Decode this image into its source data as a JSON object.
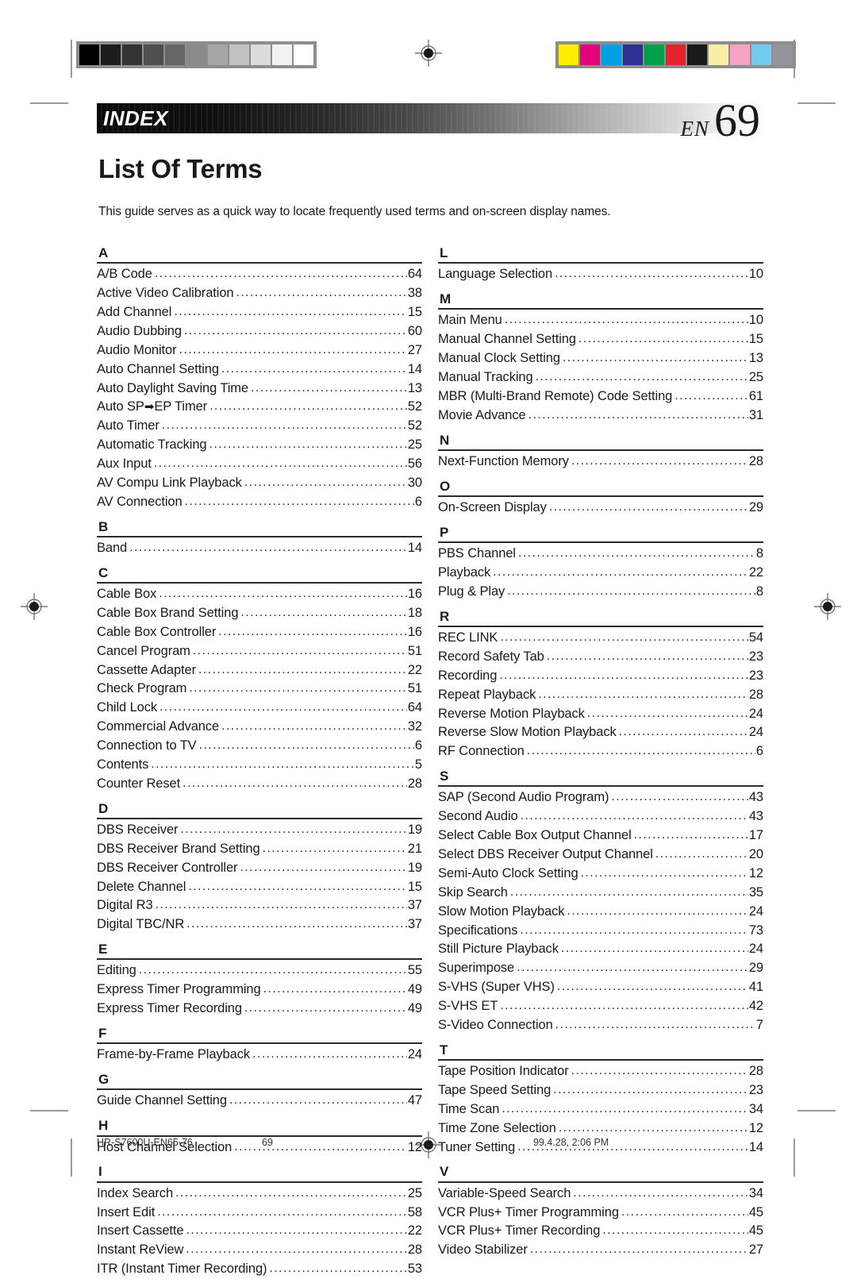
{
  "header": {
    "section_label": "INDEX",
    "locale_code": "EN",
    "page_number": "69"
  },
  "title": "List Of Terms",
  "intro": "This guide serves as a quick way to locate frequently used terms and on-screen display names.",
  "calibration": {
    "grayscale_steps": [
      "#000000",
      "#1c1c1c",
      "#333333",
      "#4f4f4f",
      "#666666",
      "#8a8a8a",
      "#a6a6a6",
      "#c2c2c2",
      "#dcdcdc",
      "#f2f2f2",
      "#ffffff"
    ],
    "color_steps": [
      "#ffec00",
      "#e5007e",
      "#00a0e3",
      "#2e3192",
      "#00a04a",
      "#e8222a",
      "#1a1a1a",
      "#faeea0",
      "#f4a3c4",
      "#6fcdf2",
      "#939598"
    ]
  },
  "columns": [
    {
      "groups": [
        {
          "letter": "A",
          "entries": [
            {
              "term": "A/B Code",
              "page": "64"
            },
            {
              "term": "Active Video Calibration",
              "page": "38"
            },
            {
              "term": "Add Channel",
              "page": "15"
            },
            {
              "term": "Audio Dubbing",
              "page": "60"
            },
            {
              "term": "Audio Monitor",
              "page": "27"
            },
            {
              "term": "Auto Channel Setting",
              "page": "14"
            },
            {
              "term": "Auto Daylight Saving Time",
              "page": "13"
            },
            {
              "term": "Auto SP→EP Timer",
              "page": "52"
            },
            {
              "term": "Auto Timer",
              "page": "52"
            },
            {
              "term": "Automatic Tracking",
              "page": "25"
            },
            {
              "term": "Aux Input",
              "page": "56"
            },
            {
              "term": "AV Compu Link Playback",
              "page": "30"
            },
            {
              "term": "AV Connection",
              "page": "6"
            }
          ]
        },
        {
          "letter": "B",
          "entries": [
            {
              "term": "Band",
              "page": "14"
            }
          ]
        },
        {
          "letter": "C",
          "entries": [
            {
              "term": "Cable Box",
              "page": "16"
            },
            {
              "term": "Cable Box Brand Setting",
              "page": "18"
            },
            {
              "term": "Cable Box Controller",
              "page": "16"
            },
            {
              "term": "Cancel Program",
              "page": "51"
            },
            {
              "term": "Cassette Adapter",
              "page": "22"
            },
            {
              "term": "Check Program",
              "page": "51"
            },
            {
              "term": "Child Lock",
              "page": "64"
            },
            {
              "term": "Commercial Advance",
              "page": "32"
            },
            {
              "term": "Connection to TV",
              "page": "6"
            },
            {
              "term": "Contents",
              "page": "5"
            },
            {
              "term": "Counter Reset",
              "page": "28"
            }
          ]
        },
        {
          "letter": "D",
          "entries": [
            {
              "term": "DBS Receiver",
              "page": "19"
            },
            {
              "term": "DBS Receiver Brand Setting",
              "page": "21"
            },
            {
              "term": "DBS Receiver Controller",
              "page": "19"
            },
            {
              "term": "Delete Channel",
              "page": "15"
            },
            {
              "term": "Digital R3",
              "page": "37"
            },
            {
              "term": "Digital TBC/NR",
              "page": "37"
            }
          ]
        },
        {
          "letter": "E",
          "entries": [
            {
              "term": "Editing",
              "page": "55"
            },
            {
              "term": "Express Timer Programming",
              "page": "49"
            },
            {
              "term": "Express Timer Recording",
              "page": "49"
            }
          ]
        },
        {
          "letter": "F",
          "entries": [
            {
              "term": "Frame-by-Frame Playback",
              "page": "24"
            }
          ]
        },
        {
          "letter": "G",
          "entries": [
            {
              "term": "Guide Channel Setting",
              "page": "47"
            }
          ]
        },
        {
          "letter": "H",
          "entries": [
            {
              "term": "Host Channel Selection",
              "page": "12"
            }
          ]
        },
        {
          "letter": "I",
          "entries": [
            {
              "term": "Index Search",
              "page": "25"
            },
            {
              "term": "Insert Edit",
              "page": "58"
            },
            {
              "term": "Insert Cassette",
              "page": "22"
            },
            {
              "term": "Instant ReView",
              "page": "28"
            },
            {
              "term": "ITR (Instant Timer Recording)",
              "page": "53"
            }
          ]
        }
      ]
    },
    {
      "groups": [
        {
          "letter": "L",
          "entries": [
            {
              "term": "Language Selection",
              "page": "10"
            }
          ]
        },
        {
          "letter": "M",
          "entries": [
            {
              "term": "Main Menu",
              "page": "10"
            },
            {
              "term": "Manual Channel Setting",
              "page": "15"
            },
            {
              "term": "Manual Clock Setting",
              "page": "13"
            },
            {
              "term": "Manual Tracking",
              "page": "25"
            },
            {
              "term": "MBR (Multi-Brand Remote) Code Setting",
              "page": "61"
            },
            {
              "term": "Movie Advance",
              "page": "31"
            }
          ]
        },
        {
          "letter": "N",
          "entries": [
            {
              "term": "Next-Function Memory",
              "page": "28"
            }
          ]
        },
        {
          "letter": "O",
          "entries": [
            {
              "term": "On-Screen Display",
              "page": "29"
            }
          ]
        },
        {
          "letter": "P",
          "entries": [
            {
              "term": "PBS Channel",
              "page": "8"
            },
            {
              "term": "Playback",
              "page": "22"
            },
            {
              "term": "Plug & Play",
              "page": "8"
            }
          ]
        },
        {
          "letter": "R",
          "entries": [
            {
              "term": "REC LINK",
              "page": "54"
            },
            {
              "term": "Record Safety Tab",
              "page": "23"
            },
            {
              "term": "Recording",
              "page": "23"
            },
            {
              "term": "Repeat Playback",
              "page": "28"
            },
            {
              "term": "Reverse Motion Playback",
              "page": "24"
            },
            {
              "term": "Reverse Slow Motion Playback",
              "page": "24"
            },
            {
              "term": "RF Connection",
              "page": "6"
            }
          ]
        },
        {
          "letter": "S",
          "entries": [
            {
              "term": "SAP (Second Audio Program)",
              "page": "43"
            },
            {
              "term": "Second Audio",
              "page": "43"
            },
            {
              "term": "Select Cable Box Output Channel",
              "page": "17"
            },
            {
              "term": "Select DBS Receiver Output Channel",
              "page": "20"
            },
            {
              "term": "Semi-Auto Clock Setting",
              "page": "12"
            },
            {
              "term": "Skip Search",
              "page": "35"
            },
            {
              "term": "Slow Motion Playback",
              "page": "24"
            },
            {
              "term": "Specifications",
              "page": "73"
            },
            {
              "term": "Still Picture Playback",
              "page": "24"
            },
            {
              "term": "Superimpose",
              "page": "29"
            },
            {
              "term": "S-VHS (Super VHS)",
              "page": "41"
            },
            {
              "term": "S-VHS ET",
              "page": "42"
            },
            {
              "term": "S-Video Connection",
              "page": "7"
            }
          ]
        },
        {
          "letter": "T",
          "entries": [
            {
              "term": "Tape Position Indicator",
              "page": "28"
            },
            {
              "term": "Tape Speed Setting",
              "page": "23"
            },
            {
              "term": "Time Scan",
              "page": "34"
            },
            {
              "term": "Time Zone Selection",
              "page": "12"
            },
            {
              "term": "Tuner Setting",
              "page": "14"
            }
          ]
        },
        {
          "letter": "V",
          "entries": [
            {
              "term": "Variable-Speed Search",
              "page": "34"
            },
            {
              "term": "VCR Plus+ Timer Programming",
              "page": "45"
            },
            {
              "term": "VCR Plus+ Timer Recording",
              "page": "45"
            },
            {
              "term": "Video Stabilizer",
              "page": "27"
            }
          ]
        }
      ]
    }
  ],
  "footer": {
    "doc_id": "HR-S7600U-EN65-76",
    "page": "69",
    "timestamp": "99.4.28, 2:06 PM"
  }
}
